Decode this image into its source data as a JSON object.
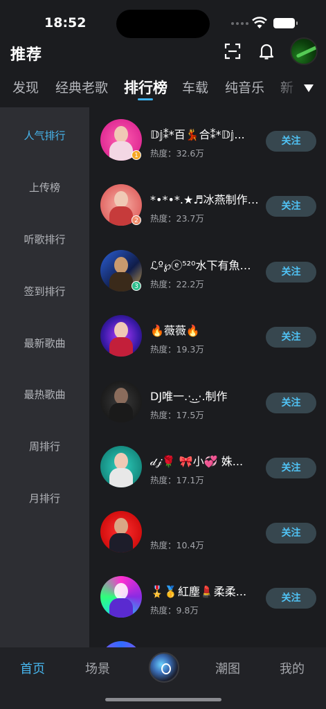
{
  "status": {
    "time": "18:52"
  },
  "header": {
    "title": "推荐"
  },
  "tabs": [
    "发现",
    "经典老歌",
    "排行榜",
    "车载",
    "纯音乐",
    "新"
  ],
  "active_tab": "排行榜",
  "sidebar": {
    "items": [
      "人气排行",
      "上传榜",
      "听歌排行",
      "签到排行",
      "最新歌曲",
      "最热歌曲",
      "周排行",
      "月排行"
    ],
    "active": "人气排行"
  },
  "list": {
    "follow_label": "关注",
    "rows": [
      {
        "name": "𝔻𝕛⁑*百💃合⁑*𝔻𝕛...",
        "heat": "热度：32.6万",
        "rank": "1",
        "rank_color": "#f5a623"
      },
      {
        "name": "*•*•*.★♬冰燕制作•...",
        "heat": "热度：23.7万",
        "rank": "2",
        "rank_color": "#ef8b6a"
      },
      {
        "name": "ℒº℘ⓔ⁵²⁰水下有魚🎤...",
        "heat": "热度：22.2万",
        "rank": "3",
        "rank_color": "#2fbf8c"
      },
      {
        "name": "🔥薇薇🔥",
        "heat": "热度：19.3万"
      },
      {
        "name": "DJ唯一.·.͜.·.制作",
        "heat": "热度：17.5万"
      },
      {
        "name": "𝒹𝒿🌹 🎀小💞 姝...",
        "heat": "热度：17.1万"
      },
      {
        "name": "",
        "heat": "热度：10.4万"
      },
      {
        "name": "🎖️🥇紅塵💄柔柔...",
        "heat": "热度：9.8万"
      }
    ]
  },
  "bottom_nav": {
    "items": [
      "首页",
      "场景",
      "潮图",
      "我的"
    ],
    "active": "首页"
  },
  "colors": {
    "accent": "#47b6ee",
    "follow_bg": "#37474f",
    "sidebar_bg": "#2d2e33",
    "background": "#1b1c1f"
  }
}
